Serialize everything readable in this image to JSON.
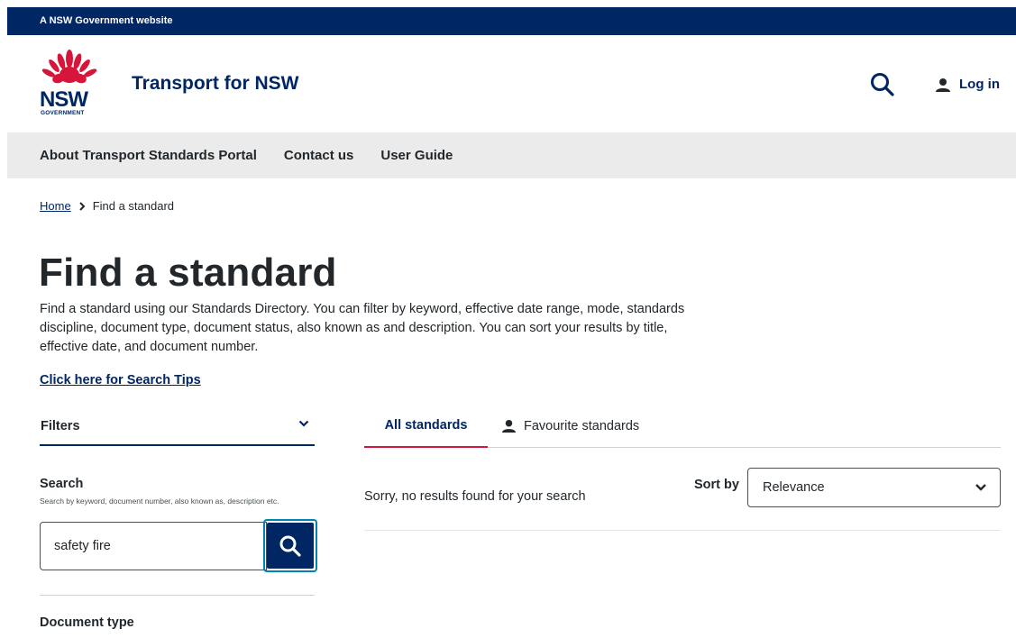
{
  "masthead": {
    "text": "A NSW Government website"
  },
  "header": {
    "logo": {
      "text": "NSW",
      "subtext": "GOVERNMENT"
    },
    "site_title": "Transport for NSW",
    "login_label": "Log in"
  },
  "nav": {
    "items": [
      {
        "label": "About Transport Standards Portal"
      },
      {
        "label": "Contact us"
      },
      {
        "label": "User Guide"
      }
    ]
  },
  "breadcrumb": {
    "home": "Home",
    "current": "Find a standard"
  },
  "page": {
    "title": "Find a standard",
    "intro": "Find a standard using our Standards Directory. You can filter by keyword, effective date range, mode, standards discipline, document type, document status, also known as and description. You can sort your results by title, effective date, and document number.",
    "tips_link": "Click here for Search Tips"
  },
  "filters": {
    "label": "Filters",
    "search_heading": "Search",
    "search_hint": "Search by keyword, document number, also known as, description etc.",
    "search_value": "safety fire",
    "doc_type_heading": "Document type"
  },
  "tabs": {
    "all": "All standards",
    "favourites": "Favourite standards",
    "active": "All standards"
  },
  "results": {
    "message": "Sorry, no results found for your search",
    "sort_label": "Sort by",
    "sort_value": "Relevance"
  },
  "colors": {
    "navy": "#002664",
    "red": "#d7153a",
    "focus_ring": "#0085b3",
    "nav_bg": "#ebebeb"
  },
  "icons": {
    "header_search": "search-icon",
    "login": "person-icon",
    "filters_toggle": "chevron-down-icon",
    "search_submit": "search-icon",
    "favourites": "person-icon",
    "sort": "chevron-down-icon"
  }
}
